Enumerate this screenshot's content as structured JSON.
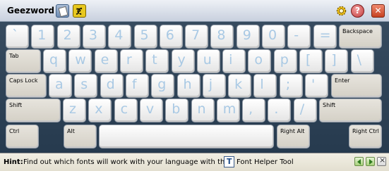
{
  "window": {
    "title": "Geezword"
  },
  "toolbar": {
    "icons": [
      "document-icon",
      "font-icon",
      "gear-icon",
      "help-icon",
      "close-icon"
    ],
    "help_glyph": "?",
    "close_glyph": "✕"
  },
  "keyboard": {
    "row1": [
      "`",
      "1",
      "2",
      "3",
      "4",
      "5",
      "6",
      "7",
      "8",
      "9",
      "0",
      "-",
      "="
    ],
    "backspace": "Backspace",
    "tab": "Tab",
    "row2": [
      "q",
      "w",
      "e",
      "r",
      "t",
      "y",
      "u",
      "i",
      "o",
      "p",
      "[",
      "]",
      "\\"
    ],
    "caps_lock": "Caps Lock",
    "row3": [
      "a",
      "s",
      "d",
      "f",
      "g",
      "h",
      "j",
      "k",
      "l",
      ";",
      "'"
    ],
    "enter": "Enter",
    "shift_left": "Shift",
    "row4": [
      "z",
      "x",
      "c",
      "v",
      "b",
      "n",
      "m",
      ",",
      ".",
      "/"
    ],
    "shift_right": "Shift",
    "ctrl_left": "Ctrl",
    "alt_left": "Alt",
    "space": "",
    "right_alt": "Right Alt",
    "right_ctrl": "Right Ctrl"
  },
  "hint": {
    "label": "Hint:",
    "text": "Find out which fonts will work with your language with the",
    "tool": "Font Helper Tool"
  },
  "colors": {
    "key_face": "#ffffff",
    "key_glyph": "#a9c9e4",
    "background": "#2e4052"
  }
}
